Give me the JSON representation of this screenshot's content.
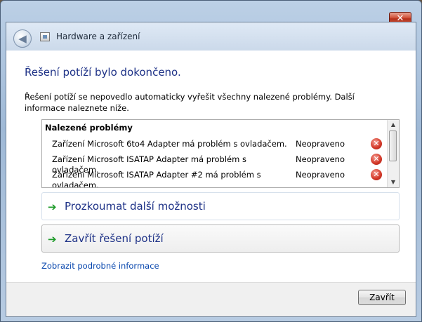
{
  "window": {
    "title": "Hardware a zařízení",
    "close_glyph": "✕"
  },
  "content": {
    "heading": "Řešení potíží bylo dokončeno.",
    "description": "Řešení potíží se nepovedlo automaticky vyřešit všechny nalezené problémy. Další informace naleznete níže."
  },
  "problems": {
    "header": "Nalezené problémy",
    "items": [
      {
        "name": "Zařízení Microsoft 6to4 Adapter má problém s ovladačem.",
        "status": "Neopraveno"
      },
      {
        "name": "Zařízení Microsoft ISATAP Adapter má problém s ovladačem.",
        "status": "Neopraveno"
      },
      {
        "name": "Zařízení Microsoft ISATAP Adapter #2 má problém s ovladačem.",
        "status": "Neopraveno"
      }
    ],
    "error_glyph": "✕"
  },
  "commands": {
    "explore": "Prozkoumat další možnosti",
    "close_troubleshooting": "Zavřít řešení potíží",
    "arrow_glyph": "➔"
  },
  "links": {
    "details": "Zobrazit podrobné informace"
  },
  "footer": {
    "close_button": "Zavřít"
  },
  "icons": {
    "back": "back-arrow-icon",
    "title": "hardware-icon",
    "error": "error-icon",
    "arrow": "green-arrow-icon"
  },
  "colors": {
    "heading": "#1e3287",
    "link": "#0645ad",
    "arrow": "#1e9b2a",
    "error": "#d53b2b"
  }
}
